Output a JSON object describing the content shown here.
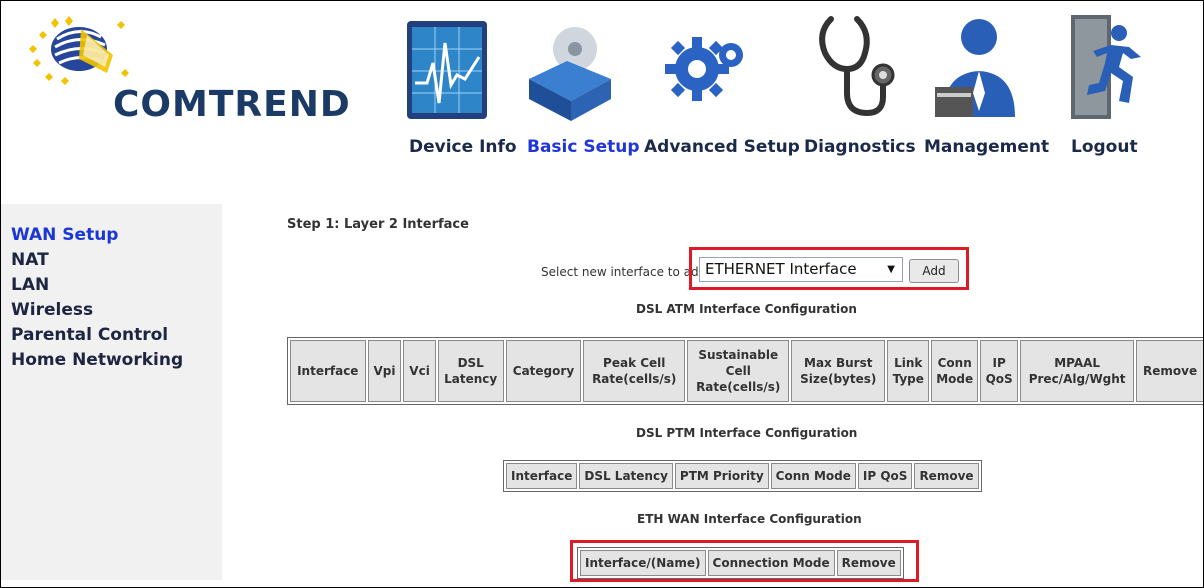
{
  "brand": {
    "name": "COMTREND"
  },
  "nav": {
    "items": [
      {
        "label": "Device Info",
        "icon": "device-info-icon"
      },
      {
        "label": "Basic Setup",
        "icon": "basic-setup-icon",
        "active": true
      },
      {
        "label": "Advanced Setup",
        "icon": "advanced-setup-icon"
      },
      {
        "label": "Diagnostics",
        "icon": "diagnostics-icon"
      },
      {
        "label": "Management",
        "icon": "management-icon"
      },
      {
        "label": "Logout",
        "icon": "logout-icon"
      }
    ]
  },
  "sidebar": {
    "items": [
      {
        "label": "WAN Setup",
        "active": true
      },
      {
        "label": "NAT"
      },
      {
        "label": "LAN"
      },
      {
        "label": "Wireless"
      },
      {
        "label": "Parental Control"
      },
      {
        "label": "Home Networking"
      }
    ]
  },
  "main": {
    "step_title": "Step 1: Layer 2 Interface",
    "select_label": "Select new interface to add:",
    "select_value": "ETHERNET Interface",
    "add_button": "Add",
    "atm": {
      "title": "DSL ATM Interface Configuration",
      "headers": [
        "Interface",
        "Vpi",
        "Vci",
        "DSL Latency",
        "Category",
        "Peak Cell Rate(cells/s)",
        "Sustainable Cell Rate(cells/s)",
        "Max Burst Size(bytes)",
        "Link Type",
        "Conn Mode",
        "IP QoS",
        "MPAAL Prec/Alg/Wght",
        "Remove"
      ]
    },
    "ptm": {
      "title": "DSL PTM Interface Configuration",
      "headers": [
        "Interface",
        "DSL Latency",
        "PTM Priority",
        "Conn Mode",
        "IP QoS",
        "Remove"
      ]
    },
    "eth": {
      "title": "ETH WAN Interface Configuration",
      "headers": [
        "Interface/(Name)",
        "Connection Mode",
        "Remove"
      ]
    }
  },
  "colors": {
    "accent": "#2036d8",
    "highlight_box": "#dd1b26",
    "sidebar_bg": "#f1f1f1",
    "header_cell_bg": "#e4e4e4"
  }
}
